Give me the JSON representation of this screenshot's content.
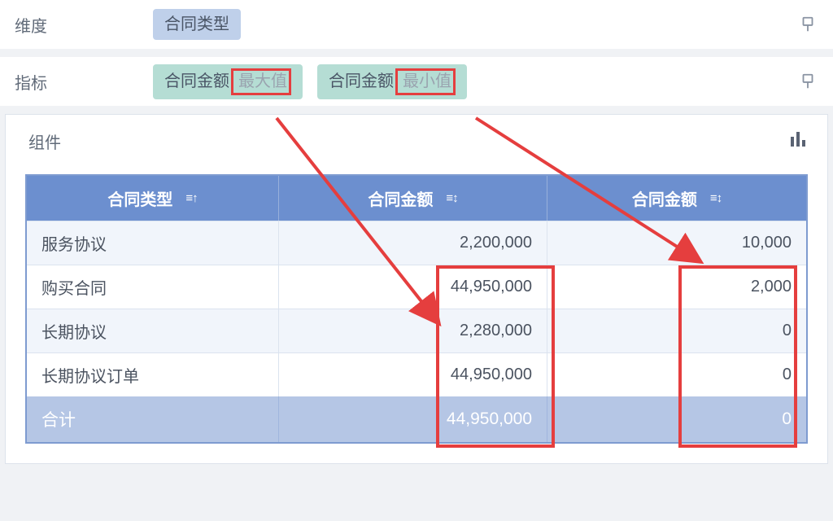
{
  "rows": {
    "dimension": {
      "label": "维度",
      "chips": [
        {
          "text": "合同类型",
          "agg": ""
        }
      ]
    },
    "metric": {
      "label": "指标",
      "chips": [
        {
          "text": "合同金额",
          "agg": "最大值"
        },
        {
          "text": "合同金额",
          "agg": "最小值"
        }
      ]
    }
  },
  "panel": {
    "title": "组件"
  },
  "table": {
    "headers": [
      "合同类型",
      "合同金额",
      "合同金额"
    ],
    "rows": [
      {
        "name": "服务协议",
        "max": "2,200,000",
        "min": "10,000"
      },
      {
        "name": "购买合同",
        "max": "44,950,000",
        "min": "2,000"
      },
      {
        "name": "长期协议",
        "max": "2,280,000",
        "min": "0"
      },
      {
        "name": "长期协议订单",
        "max": "44,950,000",
        "min": "0"
      }
    ],
    "footer": {
      "name": "合计",
      "max": "44,950,000",
      "min": "0"
    }
  },
  "chart_data": {
    "type": "table",
    "title": "合同金额 最大值/最小值 按合同类型",
    "categories": [
      "服务协议",
      "购买合同",
      "长期协议",
      "长期协议订单"
    ],
    "series": [
      {
        "name": "合同金额 最大值",
        "values": [
          2200000,
          44950000,
          2280000,
          44950000
        ]
      },
      {
        "name": "合同金额 最小值",
        "values": [
          10000,
          2000,
          0,
          0
        ]
      }
    ],
    "totals": {
      "合同金额 最大值": 44950000,
      "合同金额 最小值": 0
    }
  }
}
